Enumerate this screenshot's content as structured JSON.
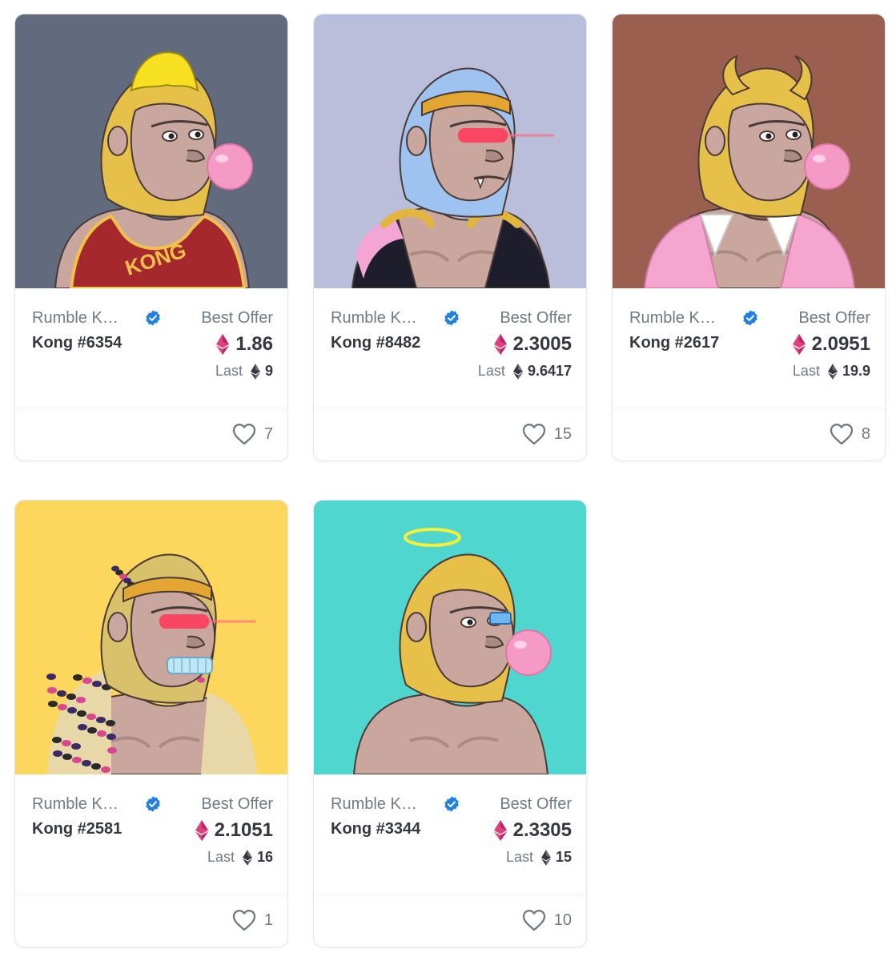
{
  "cards": [
    {
      "collection": "Rumble Kong League",
      "token": "Kong #6354",
      "offer_label": "Best Offer",
      "price": "1.86",
      "last_label": "Last",
      "last": "9",
      "likes": "7",
      "bg": "#626a7e",
      "fur": "#e7c04a",
      "accessory": "banana-hat",
      "mouth": "bubblegum",
      "outfit": "jersey"
    },
    {
      "collection": "Rumble Kong League",
      "token": "Kong #8482",
      "offer_label": "Best Offer",
      "price": "2.3005",
      "last_label": "Last",
      "last": "9.6417",
      "likes": "15",
      "bg": "#b9bfda",
      "fur": "#9fc3f0",
      "accessory": "headband",
      "mouth": "fang",
      "outfit": "vest"
    },
    {
      "collection": "Rumble Kong League",
      "token": "Kong #2617",
      "offer_label": "Best Offer",
      "price": "2.0951",
      "last_label": "Last",
      "last": "19.9",
      "likes": "8",
      "bg": "#9a5f4e",
      "fur": "#e7c04a",
      "accessory": "horns",
      "mouth": "bubblegum",
      "outfit": "pink-jacket"
    },
    {
      "collection": "Rumble Kong League",
      "token": "Kong #2581",
      "offer_label": "Best Offer",
      "price": "2.1051",
      "last_label": "Last",
      "last": "16",
      "likes": "1",
      "bg": "#fdd75c",
      "fur": "#d9c06a",
      "accessory": "headband",
      "mouth": "diamond-grill",
      "outfit": "leopard"
    },
    {
      "collection": "Rumble Kong League",
      "token": "Kong #3344",
      "offer_label": "Best Offer",
      "price": "2.3305",
      "last_label": "Last",
      "last": "15",
      "likes": "10",
      "bg": "#4fd6cf",
      "fur": "#e7c04a",
      "accessory": "halo",
      "mouth": "bubblegum",
      "outfit": "none"
    }
  ],
  "icons": {
    "verified": "verified-badge-icon",
    "currency_offer": "weth-icon",
    "currency_last": "eth-icon",
    "like": "heart-icon"
  },
  "colors": {
    "verified": "#2081e2",
    "weth": "#d63384",
    "eth": "#353840"
  }
}
